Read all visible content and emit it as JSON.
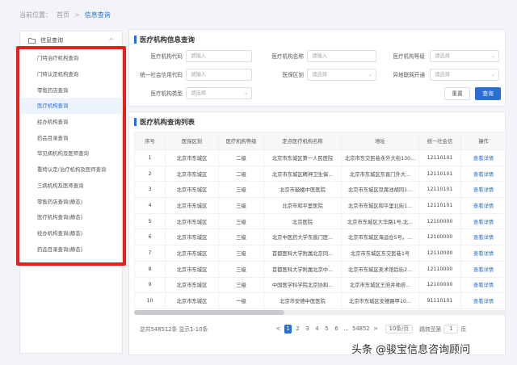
{
  "breadcrumb": {
    "label": "当前位置：",
    "home": "首页",
    "separator": ">",
    "current": "信息查询"
  },
  "sidebar": {
    "header": "信息查询",
    "items": [
      {
        "label": "门特治疗机构查询"
      },
      {
        "label": "门特认定机构查询"
      },
      {
        "label": "零售药店查询"
      },
      {
        "label": "医疗机构查询",
        "active": true
      },
      {
        "label": "经办机构查询"
      },
      {
        "label": "药品目录查询"
      },
      {
        "label": "罕见病机构及医师查询"
      },
      {
        "label": "重特认定/治疗机构及医师查询"
      },
      {
        "label": "三病机构及医师查询"
      },
      {
        "label": "零售药店查询(静态)"
      },
      {
        "label": "医疗机构查询(静态)"
      },
      {
        "label": "经办机构查询(静态)"
      },
      {
        "label": "药品目录查询(静态)"
      }
    ]
  },
  "search_panel": {
    "title": "医疗机构信息查询",
    "fields": {
      "code": {
        "label": "医疗机构代码",
        "placeholder": "请输入"
      },
      "name": {
        "label": "医疗机构名称",
        "placeholder": "请输入"
      },
      "level": {
        "label": "医疗机构等级",
        "placeholder": "请选择"
      },
      "credit": {
        "label": "统一社会信用代码",
        "placeholder": "请输入"
      },
      "district": {
        "label": "医保区划",
        "placeholder": "请选择"
      },
      "remote": {
        "label": "异地联网开通",
        "placeholder": "请选择"
      },
      "type": {
        "label": "医疗机构类型",
        "placeholder": "请选择"
      }
    },
    "reset_label": "重置",
    "query_label": "查询"
  },
  "results": {
    "title": "医疗机构查询列表",
    "columns": [
      "序号",
      "医保区划",
      "医疗机构等级",
      "定点医疗机构名称",
      "地址",
      "统一社会信",
      "操作"
    ],
    "rows": [
      [
        "1",
        "北京市东城区",
        "二级",
        "北京市东城区第一人民医院",
        "北京市东交民巷永外大街130...",
        "12110101",
        "查看详情"
      ],
      [
        "2",
        "北京市东城区",
        "二级",
        "北京市东城区精神卫生保...",
        "北京市东城区东直门外大...",
        "12110101",
        "查看详情"
      ],
      [
        "3",
        "北京市东城区",
        "三级",
        "北京市鼓楼中医医院",
        "北京市东城区豆腐池胡同1...",
        "12110101",
        "查看详情"
      ],
      [
        "4",
        "北京市东城区",
        "三级",
        "北京市和平里医院",
        "北京市东城区和平里北街1...",
        "12110101",
        "查看详情"
      ],
      [
        "5",
        "北京市东城区",
        "三级",
        "北京医院",
        "北京市东城区大华路1号,北...",
        "12100000",
        "查看详情"
      ],
      [
        "6",
        "北京市东城区",
        "三级",
        "北京中医药大学东直门医...",
        "北京市东城区海运仓5号。...",
        "12100000",
        "查看详情"
      ],
      [
        "7",
        "北京市东城区",
        "三级",
        "首都医科大学附属北京同...",
        "北京市东城区东交民巷1号",
        "12110000",
        "查看详情"
      ],
      [
        "8",
        "北京市东城区",
        "三级",
        "首都医科大学附属北京中...",
        "北京市东城区美术馆后街2...",
        "12110000",
        "查看详情"
      ],
      [
        "9",
        "北京市东城区",
        "三级",
        "中国医学科学院北京协和...",
        "北京市东城区王府井帅府...",
        "12100000",
        "查看详情"
      ],
      [
        "10",
        "北京市东城区",
        "一级",
        "北京市安德中医医院",
        "北京市东城区安德路甲10...",
        "91110101",
        "查看详情"
      ]
    ]
  },
  "pagination": {
    "total": "总共548512条 显示1-10条",
    "prev": "<",
    "pages": [
      "1",
      "2",
      "3",
      "4",
      "5",
      "6",
      "...",
      "54852"
    ],
    "next": ">",
    "page_size": "10条/页",
    "jump_label": "跳转至第",
    "jump_value": "1",
    "page_suffix": "页"
  },
  "watermark": "头条 @骏宝信息咨询顾问",
  "colors": {
    "accent": "#2a6fd6",
    "highlight_frame": "#e8201c"
  }
}
